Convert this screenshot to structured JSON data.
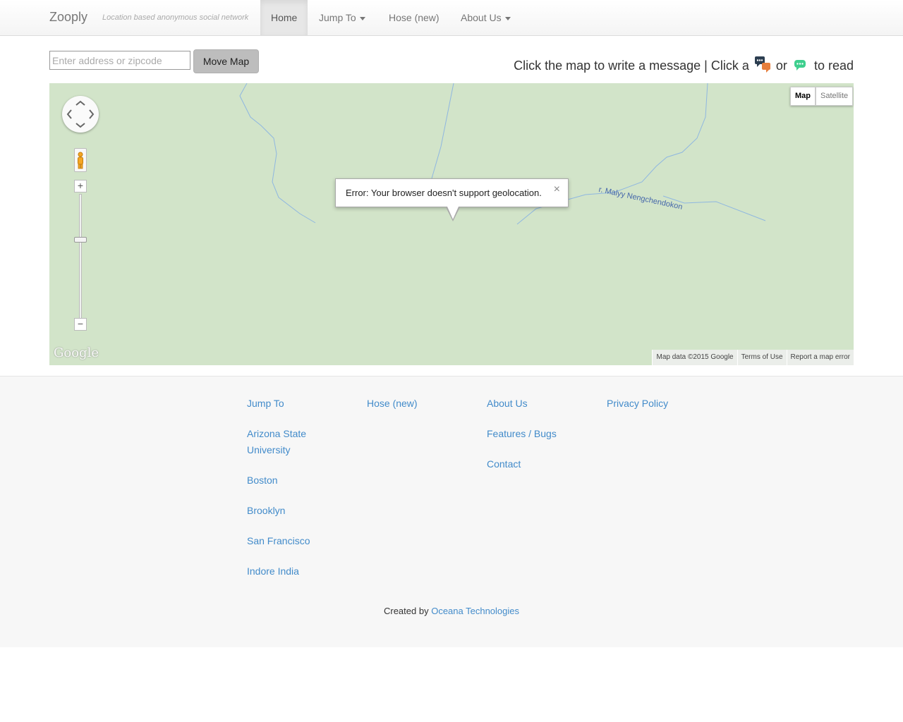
{
  "navbar": {
    "brand": "Zooply",
    "tagline": "Location based anonymous social network",
    "items": [
      {
        "label": "Home",
        "active": true,
        "dropdown": false
      },
      {
        "label": "Jump To",
        "active": false,
        "dropdown": true
      },
      {
        "label": "Hose (new)",
        "active": false,
        "dropdown": false
      },
      {
        "label": "About Us",
        "active": false,
        "dropdown": true
      }
    ]
  },
  "search": {
    "placeholder": "Enter address or zipcode",
    "value": "",
    "button_label": "Move Map"
  },
  "instructions": {
    "part1": "Click the map to write a message | Click a",
    "part2": "or",
    "part3": "to read",
    "icon1": "chat-bubbles-icon",
    "icon2": "green-chat-icon"
  },
  "map": {
    "info_window_text": "Error: Your browser doesn't support geolocation.",
    "close_glyph": "×",
    "river_label": "r. Malyy Nengchendokon",
    "map_type": {
      "map": "Map",
      "satellite": "Satellite"
    },
    "zoom_in": "+",
    "zoom_out": "−",
    "logo": "Google",
    "attribution": [
      "Map data ©2015 Google",
      "Terms of Use",
      "Report a map error"
    ]
  },
  "footer": {
    "col1": [
      "Jump To",
      "Arizona State University",
      "Boston",
      "Brooklyn",
      "San Francisco",
      "Indore India"
    ],
    "col2": [
      "Hose (new)"
    ],
    "col3": [
      "About Us",
      "Features / Bugs",
      "Contact"
    ],
    "col4": [
      "Privacy Policy"
    ],
    "credit_prefix": "Created by",
    "credit_link": "Oceana Technologies"
  },
  "colors": {
    "link": "#428bca",
    "map_bg": "#d2e4c9",
    "river": "#8fb7e0"
  }
}
